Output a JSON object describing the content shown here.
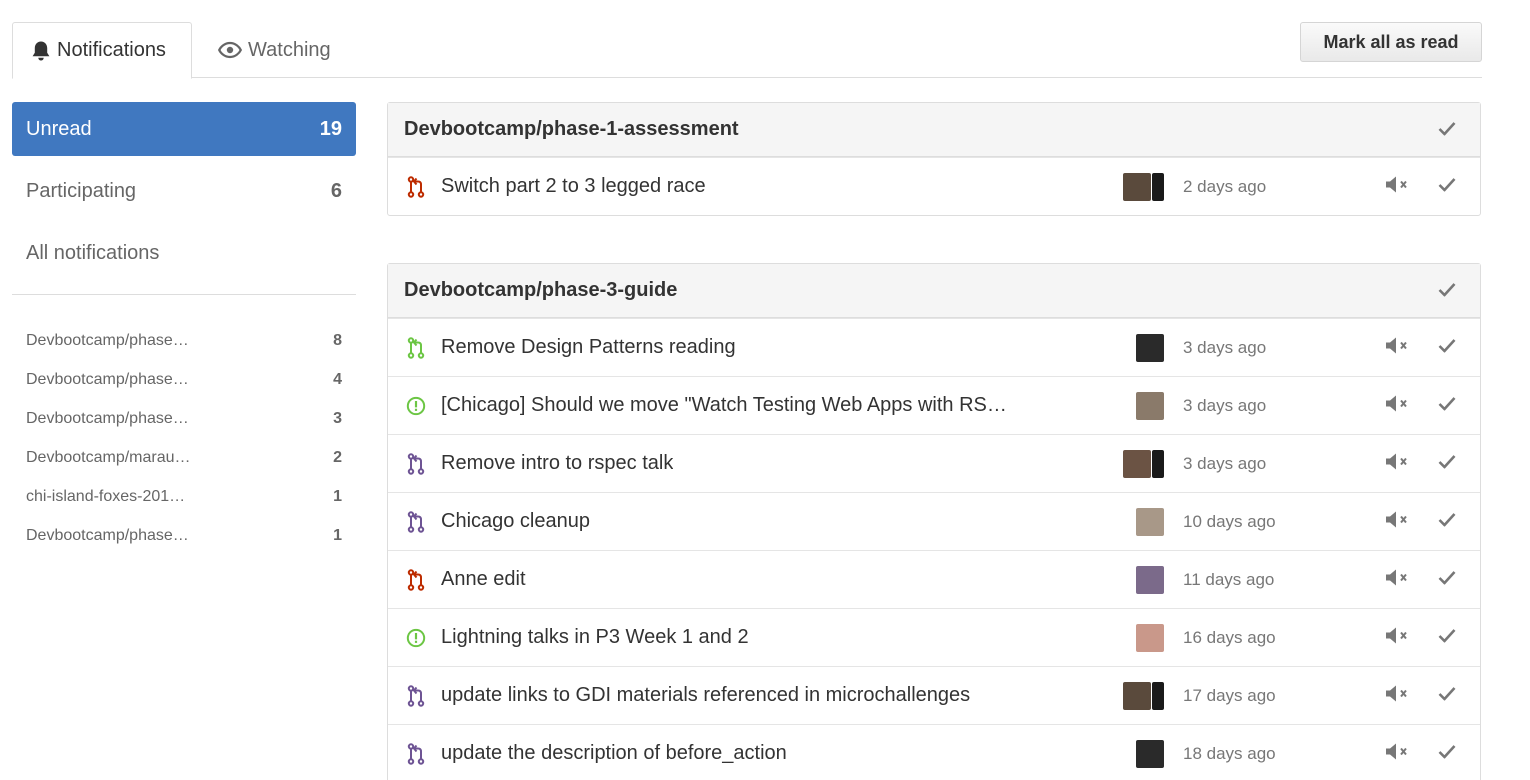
{
  "tabs": {
    "notifications_label": "Notifications",
    "watching_label": "Watching"
  },
  "mark_all_label": "Mark all as read",
  "filters": [
    {
      "label": "Unread",
      "count": "19",
      "selected": true
    },
    {
      "label": "Participating",
      "count": "6"
    },
    {
      "label": "All notifications",
      "count": ""
    }
  ],
  "repos": [
    {
      "name": "Devbootcamp/phase…",
      "count": "8"
    },
    {
      "name": "Devbootcamp/phase…",
      "count": "4"
    },
    {
      "name": "Devbootcamp/phase…",
      "count": "3"
    },
    {
      "name": "Devbootcamp/marau…",
      "count": "2"
    },
    {
      "name": "chi-island-foxes-201…",
      "count": "1"
    },
    {
      "name": "Devbootcamp/phase…",
      "count": "1"
    }
  ],
  "groups": [
    {
      "name": "Devbootcamp/phase-1-assessment",
      "items": [
        {
          "type": "pr-closed",
          "title": "Switch part 2 to 3 legged race",
          "time": "2 days ago"
        }
      ]
    },
    {
      "name": "Devbootcamp/phase-3-guide",
      "items": [
        {
          "type": "pr-open",
          "title": "Remove Design Patterns reading",
          "time": "3 days ago"
        },
        {
          "type": "issue-open",
          "title": "[Chicago] Should we move \"Watch Testing Web Apps with RS…",
          "time": "3 days ago"
        },
        {
          "type": "pr-merged",
          "title": "Remove intro to rspec talk",
          "time": "3 days ago"
        },
        {
          "type": "pr-merged",
          "title": "Chicago cleanup",
          "time": "10 days ago"
        },
        {
          "type": "pr-closed",
          "title": "Anne edit",
          "time": "11 days ago"
        },
        {
          "type": "issue-open",
          "title": "Lightning talks in P3 Week 1 and 2",
          "time": "16 days ago"
        },
        {
          "type": "pr-merged",
          "title": "update links to GDI materials referenced in microchallenges",
          "time": "17 days ago"
        },
        {
          "type": "pr-merged",
          "title": "update the description of before_action",
          "time": "18 days ago"
        }
      ]
    }
  ],
  "colors": {
    "accent": "#4078c0",
    "pr_open": "#6cc644",
    "pr_closed": "#bd2c00",
    "pr_merged": "#6e5494",
    "issue_open": "#6cc644"
  }
}
